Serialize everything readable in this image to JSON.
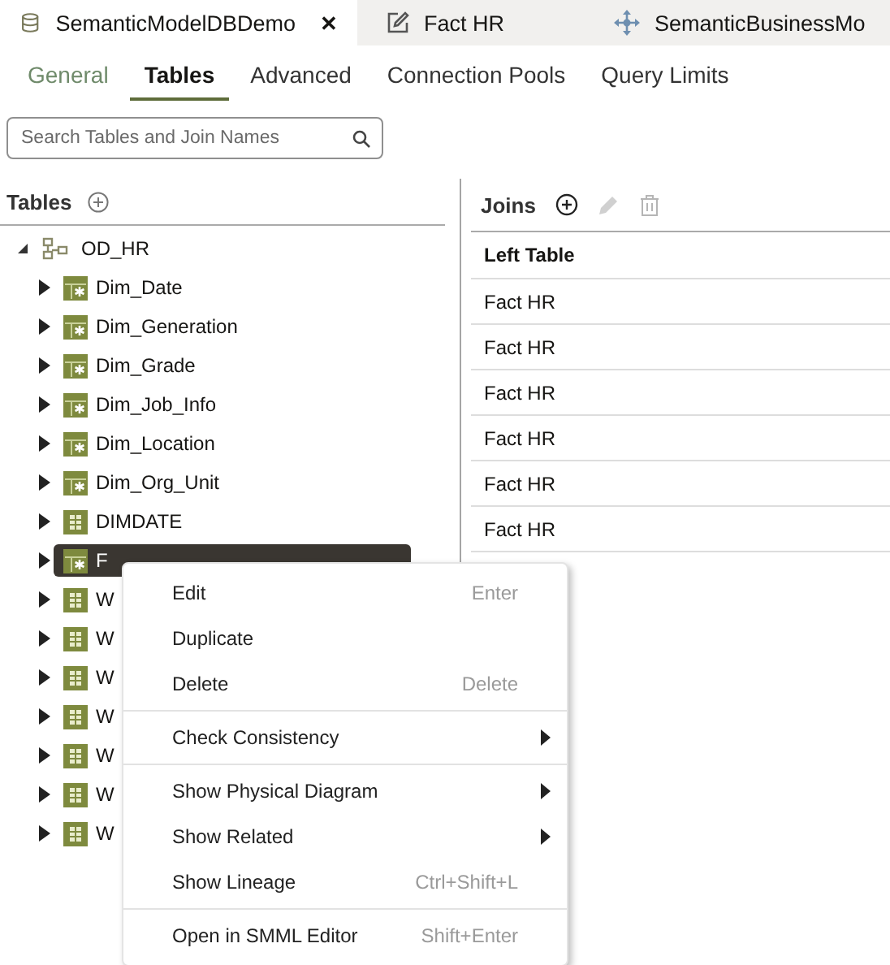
{
  "doc_tabs": [
    {
      "label": "SemanticModelDBDemo",
      "selected": true,
      "close": "✕"
    },
    {
      "label": "Fact HR",
      "selected": false
    },
    {
      "label": "SemanticBusinessMo",
      "selected": false
    }
  ],
  "sub_tabs": [
    {
      "label": "General",
      "selected": false
    },
    {
      "label": "Tables",
      "selected": true
    },
    {
      "label": "Advanced",
      "selected": false
    },
    {
      "label": "Connection Pools",
      "selected": false
    },
    {
      "label": "Query Limits",
      "selected": false
    }
  ],
  "search": {
    "placeholder": "Search Tables and Join Names"
  },
  "tables": {
    "title": "Tables",
    "tree": {
      "label": "OD_HR",
      "expanded": true,
      "children": [
        {
          "label": "Dim_Date",
          "kind": "dimension",
          "selected": false
        },
        {
          "label": "Dim_Generation",
          "kind": "dimension",
          "selected": false
        },
        {
          "label": "Dim_Grade",
          "kind": "dimension",
          "selected": false
        },
        {
          "label": "Dim_Job_Info",
          "kind": "dimension",
          "selected": false
        },
        {
          "label": "Dim_Location",
          "kind": "dimension",
          "selected": false
        },
        {
          "label": "Dim_Org_Unit",
          "kind": "dimension",
          "selected": false
        },
        {
          "label": "DIMDATE",
          "kind": "table",
          "selected": false
        },
        {
          "label": "F",
          "kind": "dimension",
          "selected": true
        },
        {
          "label": "W",
          "kind": "table",
          "selected": false
        },
        {
          "label": "W",
          "kind": "table",
          "selected": false
        },
        {
          "label": "W",
          "kind": "table",
          "selected": false
        },
        {
          "label": "W",
          "kind": "table",
          "selected": false
        },
        {
          "label": "W",
          "kind": "table",
          "selected": false
        },
        {
          "label": "W",
          "kind": "table",
          "selected": false
        },
        {
          "label": "W",
          "kind": "table",
          "selected": false
        }
      ]
    }
  },
  "joins": {
    "title": "Joins",
    "actions": [
      {
        "disabled": false
      },
      {
        "disabled": true
      },
      {
        "disabled": true
      }
    ],
    "columns": [
      "Left Table"
    ],
    "rows": [
      "Fact HR",
      "Fact HR",
      "Fact HR",
      "Fact HR",
      "Fact HR",
      "Fact HR"
    ]
  },
  "context_menu": [
    [
      {
        "label": "Edit",
        "shortcut": "Enter",
        "submenu": false
      },
      {
        "label": "Duplicate",
        "submenu": false
      },
      {
        "label": "Delete",
        "shortcut": "Delete",
        "submenu": false
      }
    ],
    [
      {
        "label": "Check Consistency",
        "submenu": true
      }
    ],
    [
      {
        "label": "Show Physical Diagram",
        "submenu": true
      },
      {
        "label": "Show Related",
        "submenu": true
      },
      {
        "label": "Show Lineage",
        "shortcut": "Ctrl+Shift+L",
        "submenu": false
      }
    ],
    [
      {
        "label": "Open in SMML Editor",
        "shortcut": "Shift+Enter",
        "submenu": false
      }
    ]
  ]
}
